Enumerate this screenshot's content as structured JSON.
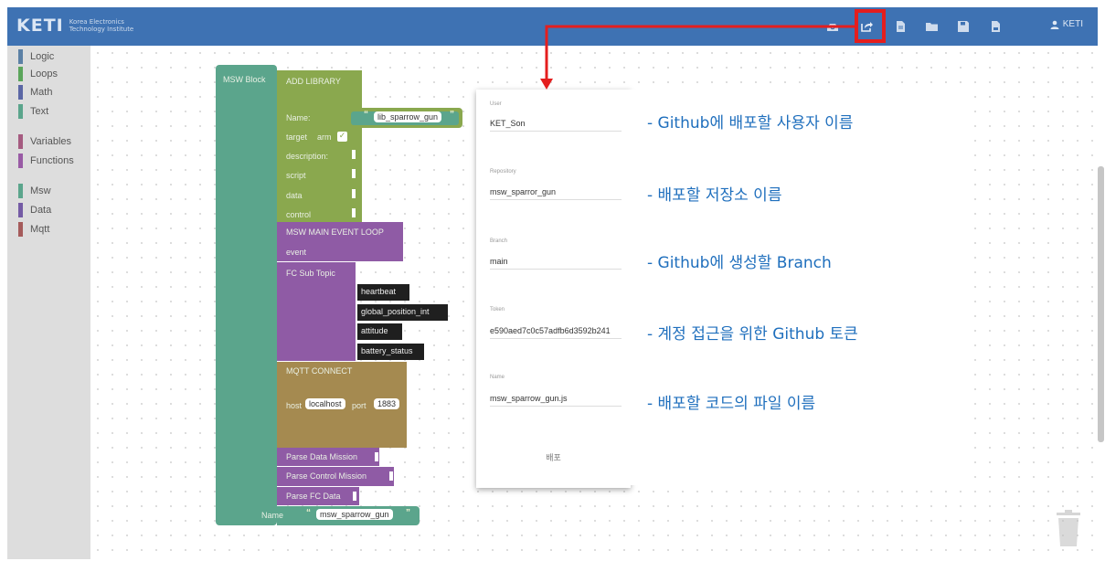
{
  "header": {
    "logo_mark": "KETI",
    "logo_line1": "Korea Electronics",
    "logo_line2": "Technology Institute",
    "tools": [
      "inbox-icon",
      "share-export-icon",
      "new-file-icon",
      "open-folder-icon",
      "save-icon",
      "save-as-file-icon"
    ],
    "user_label": "KETI",
    "colors": {
      "bar": "#3e72b3",
      "highlight": "#e41e1e"
    }
  },
  "toolbox": {
    "categories": [
      {
        "label": "Logic",
        "color": "#5b80a5"
      },
      {
        "label": "Loops",
        "color": "#5ba55b"
      },
      {
        "label": "Math",
        "color": "#5b67a5"
      },
      {
        "label": "Text",
        "color": "#5ba58c"
      },
      {
        "label": "Variables",
        "color": "#a55b80"
      },
      {
        "label": "Functions",
        "color": "#995ba5"
      },
      {
        "label": "Msw",
        "color": "#5ba58c"
      },
      {
        "label": "Data",
        "color": "#745ba5"
      },
      {
        "label": "Mqtt",
        "color": "#a55b5b"
      }
    ]
  },
  "blocks": {
    "msw_block": "MSW Block",
    "add_library": "ADD LIBRARY",
    "name_label": "Name:",
    "lib_name": "lib_sparrow_gun",
    "target_label": "target",
    "arm_label": "arm",
    "description_label": "description:",
    "script_label": "script",
    "data_label": "data",
    "control_label": "control",
    "main_event_loop": "MSW MAIN EVENT LOOP",
    "event_label": "event",
    "fc_sub_topic": "FC Sub Topic",
    "topics": [
      "heartbeat",
      "global_position_int",
      "attitude",
      "battery_status"
    ],
    "mqtt_connect": "MQTT CONNECT",
    "host_label": "host",
    "host_value": "localhost",
    "port_label": "port",
    "port_value": "1883",
    "parse_data_mission": "Parse Data Mission",
    "parse_control_mission": "Parse Control Mission",
    "parse_fc_data": "Parse FC Data",
    "bottom_name_label": "Name",
    "bottom_name_value": "msw_sparrow_gun",
    "quote_open": "“",
    "quote_close": "”"
  },
  "dialog": {
    "fields": [
      {
        "label": "User",
        "value": "KET_Son"
      },
      {
        "label": "Repository",
        "value": "msw_sparror_gun"
      },
      {
        "label": "Branch",
        "value": "main"
      },
      {
        "label": "Token",
        "value": "e590aed7c0c57adfb6d3592b241"
      },
      {
        "label": "Name",
        "value": "msw_sparrow_gun.js"
      }
    ],
    "deploy_label": "배포"
  },
  "annotations": [
    "- Github에 배포할 사용자 이름",
    "- 배포할 저장소 이름",
    "- Github에 생성할 Branch",
    "- 계정 접근을 위한 Github 토큰",
    "- 배포할 코드의 파일 이름"
  ]
}
